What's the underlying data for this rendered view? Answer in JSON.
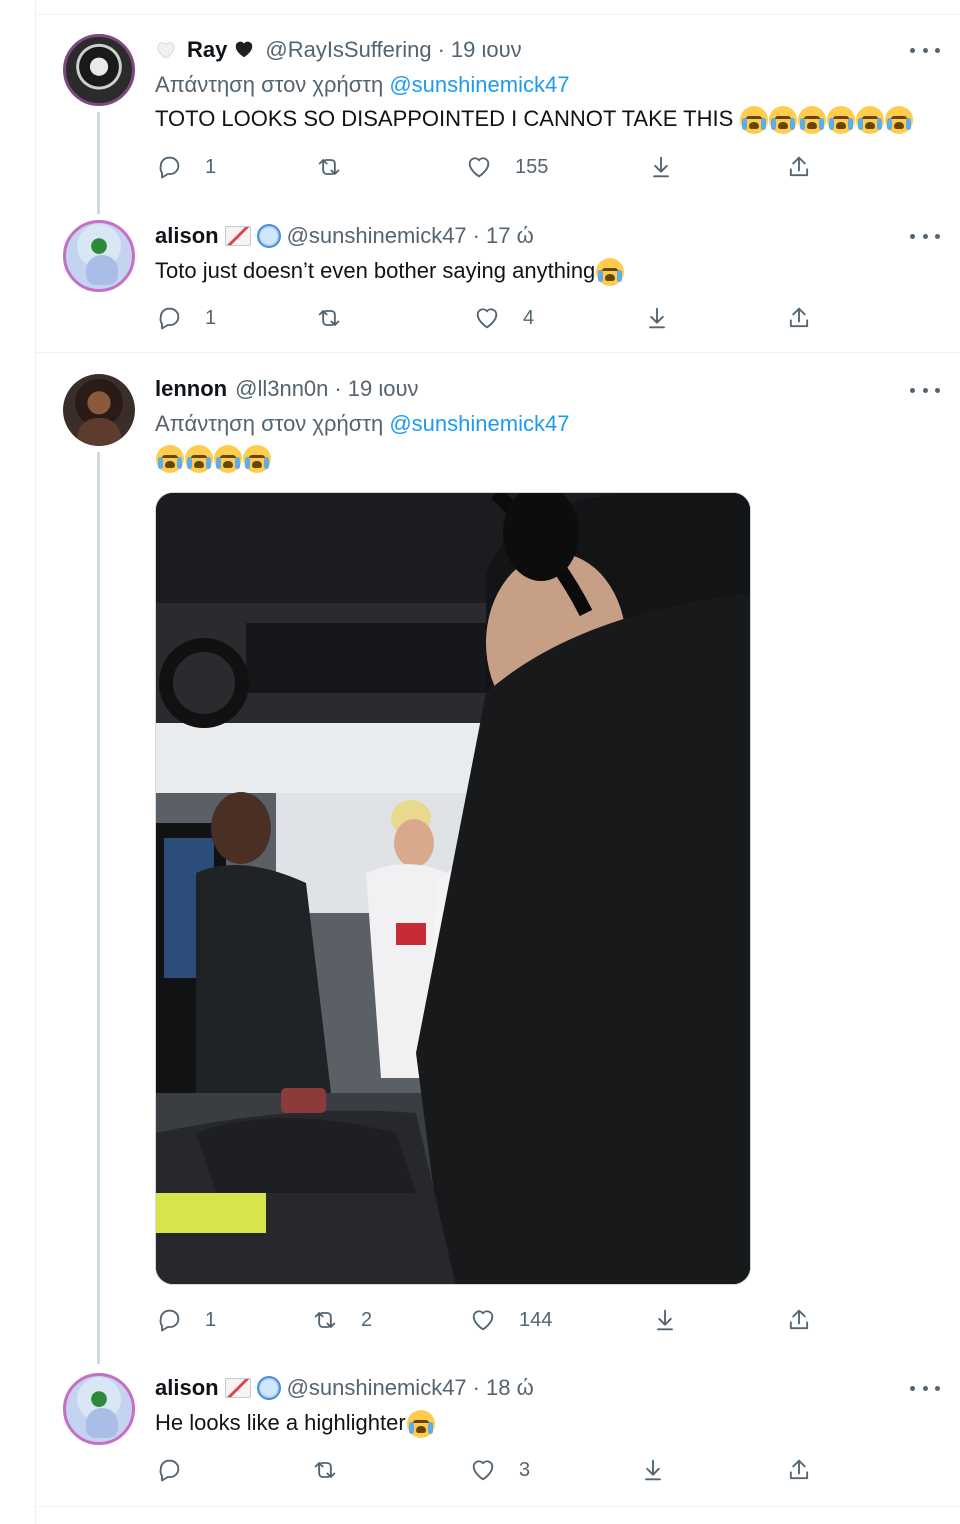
{
  "tweets": [
    {
      "name": "Ray",
      "handle": "@RayIsSuffering",
      "time": "19 ιουν",
      "reply_prefix": "Απάντηση στον χρήστη",
      "reply_mention": "@sunshinemick47",
      "text": "TOTO LOOKS SO DISAPPOINTED I CANNOT TAKE THIS",
      "emoji_count": 6,
      "replies": "1",
      "retweets": "",
      "likes": "155"
    },
    {
      "name": "alison",
      "handle": "@sunshinemick47",
      "time": "17 ώ",
      "text": "Toto just doesn’t even bother saying anything",
      "emoji_count": 1,
      "replies": "1",
      "retweets": "",
      "likes": "4"
    },
    {
      "name": "lennon",
      "handle": "@ll3nn0n",
      "time": "19 ιουν",
      "reply_prefix": "Απάντηση στον χρήστη",
      "reply_mention": "@sunshinemick47",
      "text": "",
      "emoji_count": 4,
      "replies": "1",
      "retweets": "2",
      "likes": "144"
    },
    {
      "name": "alison",
      "handle": "@sunshinemick47",
      "time": "18 ώ",
      "text": "He looks like a highlighter",
      "emoji_count": 1,
      "replies": "",
      "retweets": "",
      "likes": "3"
    }
  ],
  "separator": "·",
  "icons": {
    "reply": "reply-icon",
    "retweet": "retweet-icon",
    "like": "heart-icon",
    "bookmark": "download-icon",
    "share": "share-icon",
    "more": "more-icon"
  },
  "colors": {
    "link": "#1d9bf0",
    "secondary_text": "#536471",
    "thread_line": "#cfd9de"
  }
}
